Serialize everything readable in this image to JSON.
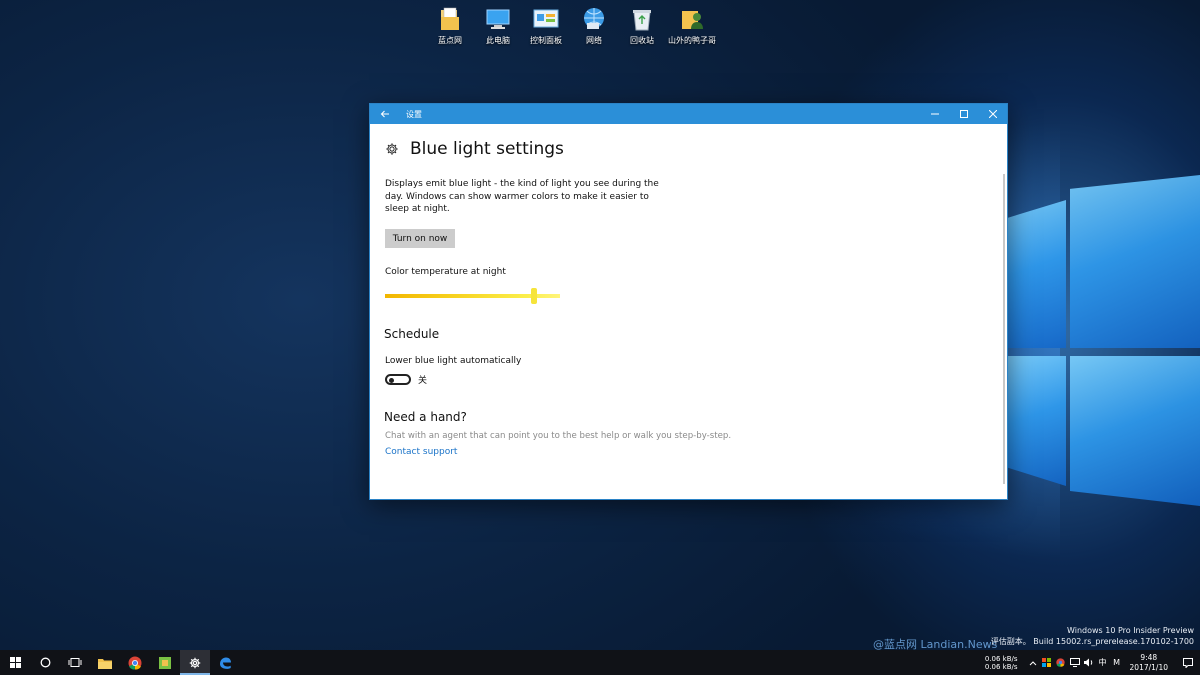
{
  "desktop": {
    "icons": [
      {
        "label": "蓝点网",
        "icon": "folder-document-icon"
      },
      {
        "label": "此电脑",
        "icon": "computer-icon"
      },
      {
        "label": "控制面板",
        "icon": "control-panel-icon"
      },
      {
        "label": "网络",
        "icon": "network-icon"
      },
      {
        "label": "回收站",
        "icon": "recycle-bin-icon"
      },
      {
        "label": "山外的鸭子哥",
        "icon": "user-folder-icon"
      }
    ]
  },
  "window": {
    "title": "设置",
    "accent": "#2b8fd8",
    "page_title": "Blue light settings",
    "description": "Displays emit blue light - the kind of light you see during the day. Windows can show warmer colors to make it easier to sleep at night.",
    "turn_on_button": "Turn on now",
    "color_temp_label": "Color temperature at night",
    "color_temp_value": 0.85,
    "schedule_heading": "Schedule",
    "lower_label": "Lower blue light automatically",
    "toggle_state": "关",
    "help_heading": "Need a hand?",
    "help_text": "Chat with an agent that can point you to the best help or walk you step-by-step.",
    "help_link": "Contact support"
  },
  "watermark": {
    "line1": "Windows 10 Pro Insider Preview",
    "line2": "评估副本。 Build 15002.rs_prerelease.170102-1700",
    "brand": "@蓝点网 Landian.News"
  },
  "taskbar": {
    "net_up": "0.06 kB/s",
    "net_down": "0.06 kB/s",
    "ime": "中",
    "ime2": "M",
    "time": "9:48",
    "date": "2017/1/10"
  }
}
